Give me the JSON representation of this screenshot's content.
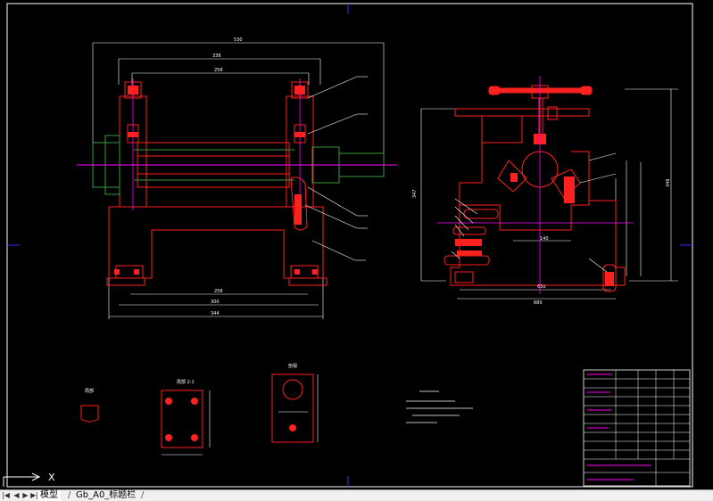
{
  "tabs": {
    "model_label": "模型",
    "layout_label": "Gb_A0_标题栏"
  },
  "ucs": {
    "x_label": "X"
  },
  "colors": {
    "background": "#000000",
    "outline": "#ffffff",
    "part": "#ff2020",
    "centerline": "#ff00ff",
    "green": "#3a9a3a",
    "frame": "#3030ff"
  },
  "annotations": {
    "detail_a": "局部",
    "detail_b": "局部 2:1",
    "detail_c": "剖视"
  }
}
